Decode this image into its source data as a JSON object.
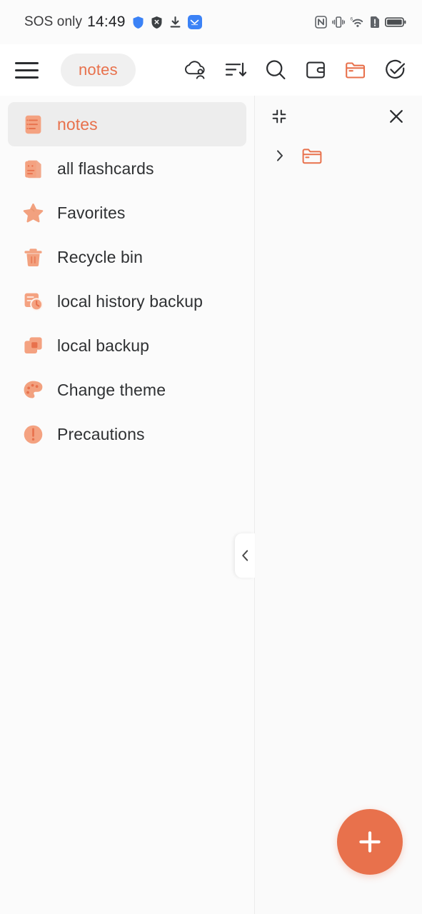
{
  "theme": {
    "accent": "#e8714c",
    "accent_soft": "#f2a383",
    "text": "#2f3133",
    "icon_dark": "#2b2d30",
    "bg": "#fbfbfb",
    "selected_bg": "#ededed"
  },
  "status_bar": {
    "carrier": "SOS only",
    "time": "14:49",
    "left_icons": [
      "shield-icon",
      "shield-off-icon",
      "download-icon",
      "app-icon"
    ],
    "right_icons": [
      "nfc-icon",
      "vibrate-icon",
      "wifi-6-icon",
      "sim-alert-icon",
      "battery-icon"
    ]
  },
  "toolbar": {
    "menu_icon": "hamburger-menu-icon",
    "chip_label": "notes",
    "actions": [
      {
        "name": "cloud-account-icon",
        "color": "#2b2d30"
      },
      {
        "name": "sort-descending-icon",
        "color": "#2b2d30"
      },
      {
        "name": "search-icon",
        "color": "#2b2d30"
      },
      {
        "name": "wallet-icon",
        "color": "#2b2d30"
      },
      {
        "name": "folder-icon",
        "color": "#e8714c"
      },
      {
        "name": "check-circle-icon",
        "color": "#2b2d30"
      }
    ]
  },
  "sidebar": {
    "items": [
      {
        "label": "notes",
        "icon": "notes-list-icon",
        "selected": true
      },
      {
        "label": "all flashcards",
        "icon": "flashcards-icon",
        "selected": false
      },
      {
        "label": "Favorites",
        "icon": "star-icon",
        "selected": false
      },
      {
        "label": "Recycle bin",
        "icon": "trash-icon",
        "selected": false
      },
      {
        "label": "local history backup",
        "icon": "history-backup-icon",
        "selected": false
      },
      {
        "label": "local backup",
        "icon": "backup-icon",
        "selected": false
      },
      {
        "label": "Change theme",
        "icon": "palette-icon",
        "selected": false
      },
      {
        "label": "Precautions",
        "icon": "warning-icon",
        "selected": false
      }
    ],
    "collapse_handle_icon": "chevron-left-icon"
  },
  "panel": {
    "collapse_icon": "collapse-corners-icon",
    "close_icon": "close-icon",
    "tree": [
      {
        "caret": "chevron-right-icon",
        "icon": "folder-icon",
        "label": ""
      }
    ]
  },
  "fab": {
    "icon": "plus-icon",
    "label": ""
  }
}
